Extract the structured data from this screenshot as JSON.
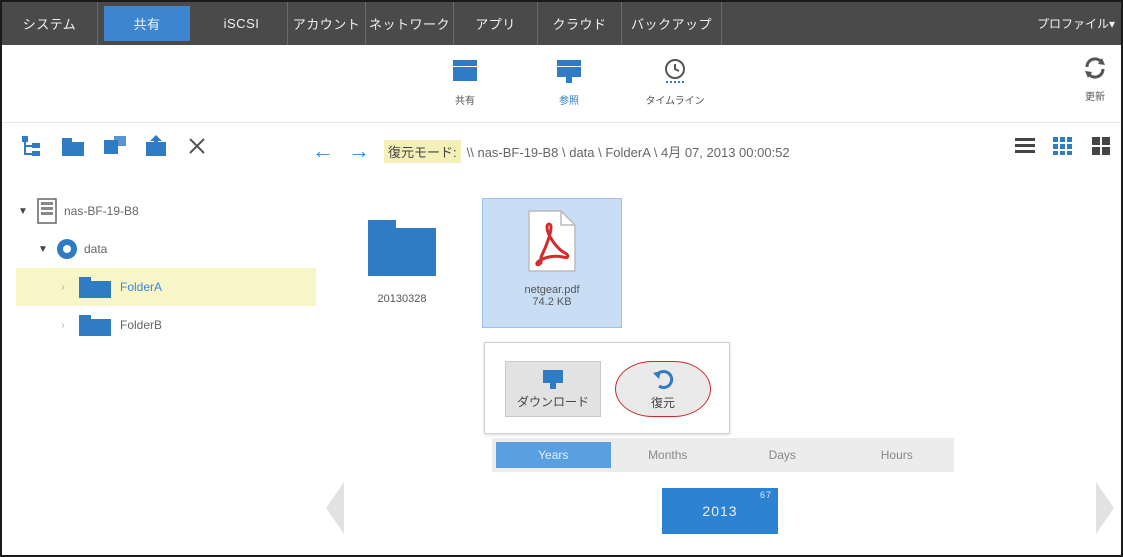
{
  "topnav": {
    "tabs": [
      {
        "label": "システム"
      },
      {
        "label": "共有"
      },
      {
        "label": "iSCSI"
      },
      {
        "label": "アカウント"
      },
      {
        "label": "ネットワーク"
      },
      {
        "label": "アプリ"
      },
      {
        "label": "クラウド"
      },
      {
        "label": "バックアップ"
      }
    ],
    "profile": "プロファイル▾"
  },
  "subbar": {
    "share_label": "共有",
    "browse_label": "参照",
    "timeline_label": "タイムライン",
    "refresh_label": "更新"
  },
  "tree": {
    "device": "nas-BF-19-B8",
    "volume": "data",
    "folders": [
      "FolderA",
      "FolderB"
    ]
  },
  "pathbar": {
    "mode_label": "復元モード:",
    "path": "\\\\ nas-BF-19-B8 \\ data \\ FolderA \\ 4月 07, 2013 00:00:52"
  },
  "files": [
    {
      "name": "20130328",
      "size": ""
    },
    {
      "name": "netgear.pdf",
      "size": "74.2 KB"
    }
  ],
  "popup": {
    "download_label": "ダウンロード",
    "restore_label": "復元"
  },
  "timeline": {
    "tabs": [
      "Years",
      "Months",
      "Days",
      "Hours"
    ],
    "active_tab": "Years",
    "year": "2013",
    "year_count": "67"
  },
  "colors": {
    "accent": "#2e82d2",
    "nav_bg": "#4a4a4a",
    "selection": "#f8f6c8",
    "restore_circle": "#cc2a2a"
  }
}
